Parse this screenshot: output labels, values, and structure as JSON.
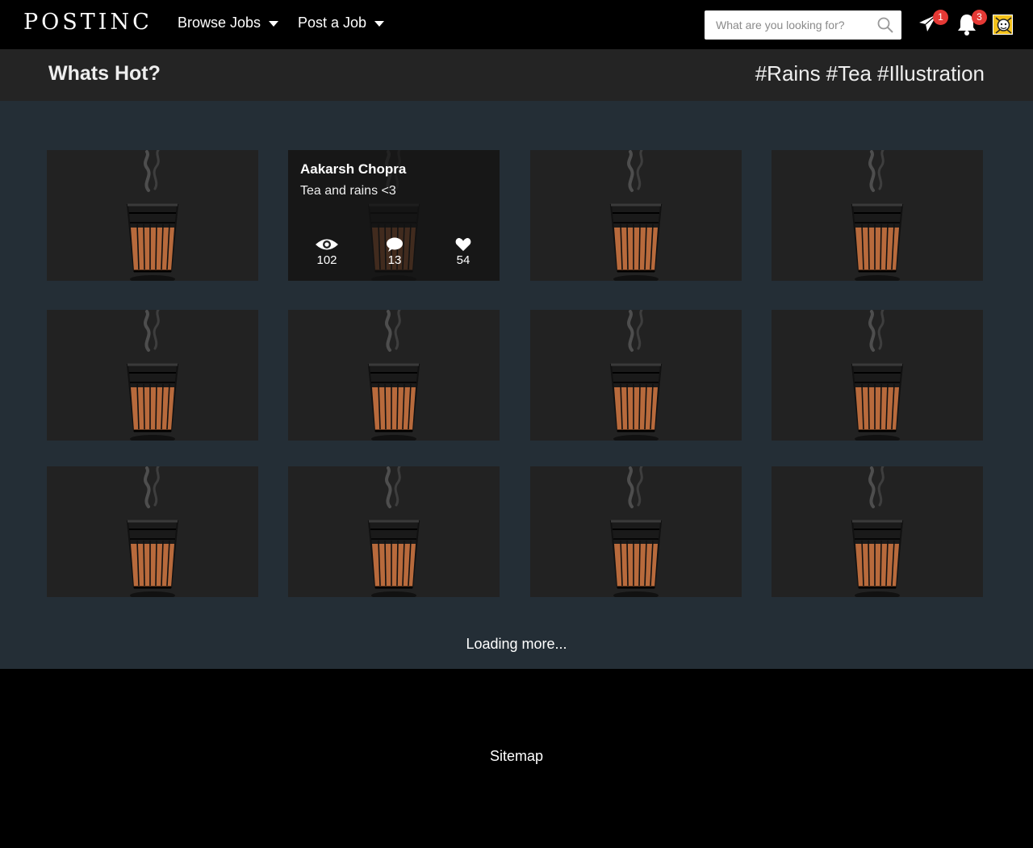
{
  "header": {
    "brand": "POSTINC",
    "nav": [
      {
        "label": "Browse Jobs"
      },
      {
        "label": "Post a Job"
      }
    ],
    "search": {
      "placeholder": "What are you looking for?",
      "value": ""
    },
    "icons": {
      "messages": {
        "icon": "paper-plane-icon",
        "badge": "1"
      },
      "notifications": {
        "icon": "bell-icon",
        "badge": "3"
      },
      "avatar": "user-avatar"
    }
  },
  "hot": {
    "title": "Whats Hot?",
    "tags": [
      "#Rains",
      "#Tea",
      "#Illustration"
    ]
  },
  "grid": {
    "item_image": "tea-glass-illustration",
    "featured": {
      "author": "Aakarsh Chopra",
      "caption": "Tea and rains <3",
      "views": "102",
      "comments": "13",
      "likes": "54"
    },
    "loading_text": "Loading more..."
  },
  "footer": {
    "sitemap": "Sitemap"
  },
  "colors": {
    "page_bg": "#000000",
    "hotbar_bg": "#242424",
    "grid_bg": "#242e36",
    "card_bg": "#222222",
    "tea": "#b86a3c",
    "badge": "#e53935",
    "avatar": "#f4c21b"
  }
}
